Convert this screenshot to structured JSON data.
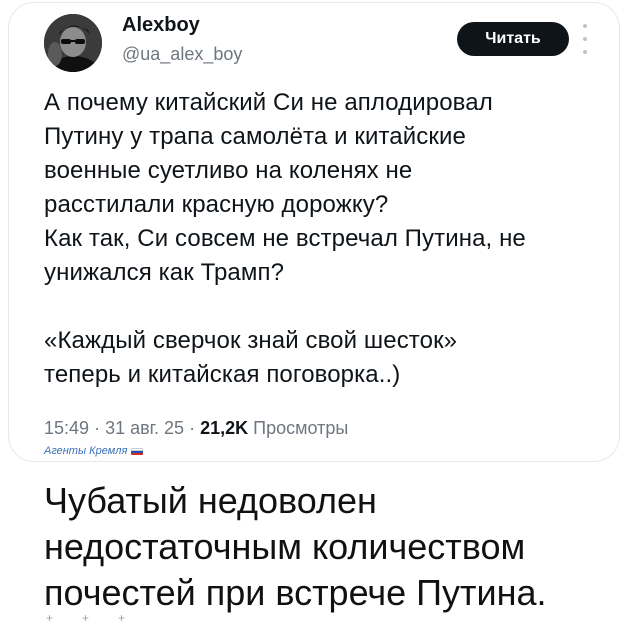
{
  "tweet": {
    "display_name": "Alexboy",
    "handle": "@ua_alex_boy",
    "follow_label": "Читать",
    "avatar_icon": "avatar-photo",
    "more_icon": "more-vertical-icon",
    "text_lines": [
      "А почему китайский Си не аплодировал",
      "Путину у трапа самолёта и китайские",
      "военные суетливо на коленях не",
      "расстилали красную дорожку?",
      "Как так, Си совсем не встречал Путина, не",
      "унижался как Трамп?",
      "",
      "«Каждый сверчок знай свой шесток»",
      "теперь и китайская поговорка..)"
    ],
    "time": "15:49",
    "date": "31 авг. 25",
    "views_count": "21,2K",
    "views_label": "Просмотры",
    "separator": "·"
  },
  "watermark": {
    "text": "Агенты Кремля",
    "flag_colors": [
      "#ffffff",
      "#1f4fb5",
      "#d52b1e"
    ]
  },
  "caption": {
    "lines": [
      "Чубатый недоволен",
      "недостаточным количеством",
      "почестей при встрече Путина."
    ]
  },
  "decorations": {
    "plus_marks": [
      "+",
      "+",
      "+"
    ]
  }
}
